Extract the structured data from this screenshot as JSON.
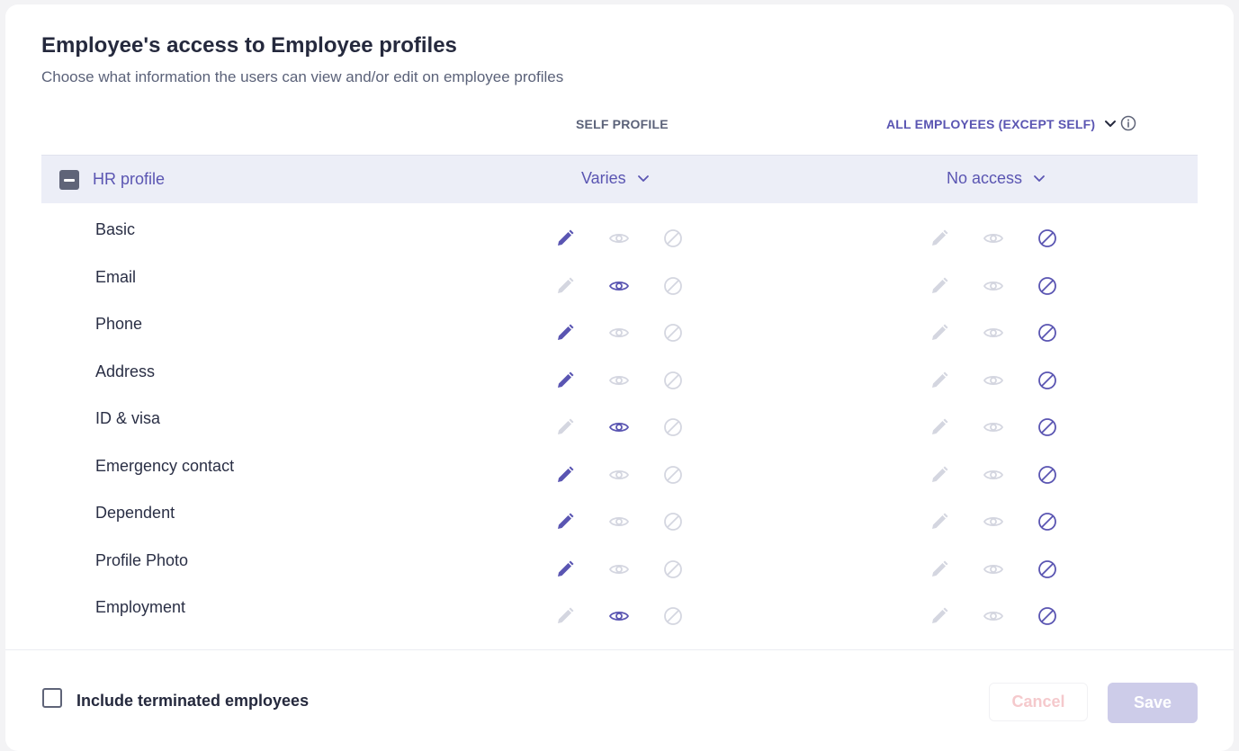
{
  "dialog": {
    "title": "Employee's access to Employee profiles",
    "subtitle": "Choose what information the users can view and/or edit on employee profiles"
  },
  "columns": {
    "self": "SELF PROFILE",
    "all": "ALL EMPLOYEES (EXCEPT SELF)"
  },
  "group": {
    "label": "HR profile",
    "self_value": "Varies",
    "all_value": "No access"
  },
  "rows": [
    {
      "label": "Basic",
      "self": "edit",
      "all": "none"
    },
    {
      "label": "Email",
      "self": "view",
      "all": "none"
    },
    {
      "label": "Phone",
      "self": "edit",
      "all": "none"
    },
    {
      "label": "Address",
      "self": "edit",
      "all": "none"
    },
    {
      "label": "ID & visa",
      "self": "view",
      "all": "none"
    },
    {
      "label": "Emergency contact",
      "self": "edit",
      "all": "none"
    },
    {
      "label": "Dependent",
      "self": "edit",
      "all": "none"
    },
    {
      "label": "Profile Photo",
      "self": "edit",
      "all": "none"
    },
    {
      "label": "Employment",
      "self": "view",
      "all": "none"
    }
  ],
  "footer": {
    "checkbox_label": "Include terminated employees",
    "checkbox_checked": false,
    "cancel_label": "Cancel",
    "save_label": "Save"
  },
  "colors": {
    "accent": "#5a55b2",
    "inactive": "#d4d6e0",
    "group_bg": "#eceef7"
  }
}
